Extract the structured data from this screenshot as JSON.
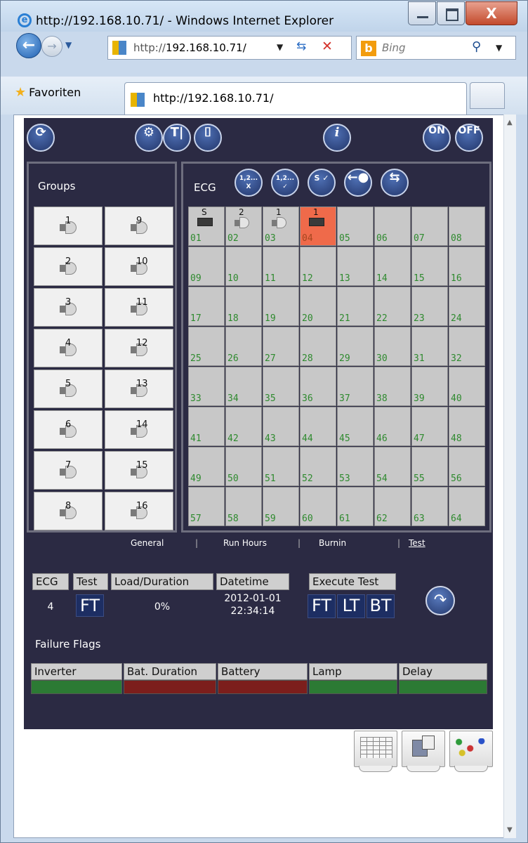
{
  "window": {
    "title": "http://192.168.10.71/ - Windows Internet Explorer",
    "close_label": "X"
  },
  "navbar": {
    "address_prefix": "http://",
    "address_host": "192.168.10.71/",
    "search_placeholder": "Bing"
  },
  "favbar": {
    "favorites_label": "Favoriten",
    "tab_label": "http://192.168.10.71/"
  },
  "toolbar": {
    "on_label": "ON",
    "off_label": "OFF",
    "info_label": "i"
  },
  "groups": {
    "title": "Groups",
    "items": [
      "1",
      "2",
      "3",
      "4",
      "5",
      "6",
      "7",
      "8",
      "9",
      "10",
      "11",
      "12",
      "13",
      "14",
      "15",
      "16"
    ]
  },
  "ecg": {
    "title": "ECG",
    "toolbar": {
      "clear_addr_label": "1,2... X",
      "assign_addr_label": "1,2... ✓",
      "set_label": "S ✓"
    },
    "cells": [
      {
        "n": "01",
        "top": "S",
        "icon": "battery",
        "state": "normal"
      },
      {
        "n": "02",
        "top": "2",
        "icon": "lamp",
        "state": "normal"
      },
      {
        "n": "03",
        "top": "1",
        "icon": "lamp",
        "state": "normal"
      },
      {
        "n": "04",
        "top": "1",
        "icon": "battery",
        "state": "selected"
      },
      {
        "n": "05"
      },
      {
        "n": "06"
      },
      {
        "n": "07"
      },
      {
        "n": "08"
      },
      {
        "n": "09"
      },
      {
        "n": "10"
      },
      {
        "n": "11"
      },
      {
        "n": "12"
      },
      {
        "n": "13"
      },
      {
        "n": "14"
      },
      {
        "n": "15"
      },
      {
        "n": "16"
      },
      {
        "n": "17"
      },
      {
        "n": "18"
      },
      {
        "n": "19"
      },
      {
        "n": "20"
      },
      {
        "n": "21"
      },
      {
        "n": "22"
      },
      {
        "n": "23"
      },
      {
        "n": "24"
      },
      {
        "n": "25"
      },
      {
        "n": "26"
      },
      {
        "n": "27"
      },
      {
        "n": "28"
      },
      {
        "n": "29"
      },
      {
        "n": "30"
      },
      {
        "n": "31"
      },
      {
        "n": "32"
      },
      {
        "n": "33"
      },
      {
        "n": "34"
      },
      {
        "n": "35"
      },
      {
        "n": "36"
      },
      {
        "n": "37"
      },
      {
        "n": "38"
      },
      {
        "n": "39"
      },
      {
        "n": "40"
      },
      {
        "n": "41"
      },
      {
        "n": "42"
      },
      {
        "n": "43"
      },
      {
        "n": "44"
      },
      {
        "n": "45"
      },
      {
        "n": "46"
      },
      {
        "n": "47"
      },
      {
        "n": "48"
      },
      {
        "n": "49"
      },
      {
        "n": "50"
      },
      {
        "n": "51"
      },
      {
        "n": "52"
      },
      {
        "n": "53"
      },
      {
        "n": "54"
      },
      {
        "n": "55"
      },
      {
        "n": "56"
      },
      {
        "n": "57"
      },
      {
        "n": "58"
      },
      {
        "n": "59"
      },
      {
        "n": "60"
      },
      {
        "n": "61"
      },
      {
        "n": "62"
      },
      {
        "n": "63"
      },
      {
        "n": "64"
      }
    ]
  },
  "tabs": [
    {
      "label": "General"
    },
    {
      "label": "Run Hours"
    },
    {
      "label": "Burnin"
    },
    {
      "label": "Test",
      "active": true
    }
  ],
  "test": {
    "headers": {
      "ecg": "ECG",
      "test": "Test",
      "load": "Load/Duration",
      "datetime": "Datetime",
      "execute": "Execute Test"
    },
    "values": {
      "ecg": "4",
      "test": "FT",
      "load": "0%",
      "date": "2012-01-01",
      "time": "22:34:14"
    },
    "execute_buttons": {
      "ft": "FT",
      "lt": "LT",
      "bt": "BT"
    }
  },
  "failure_flags": {
    "title": "Failure Flags",
    "items": [
      {
        "label": "Inverter",
        "status": "ok"
      },
      {
        "label": "Bat. Duration",
        "status": "fail"
      },
      {
        "label": "Battery",
        "status": "fail"
      },
      {
        "label": "Lamp",
        "status": "ok"
      },
      {
        "label": "Delay",
        "status": "ok"
      }
    ]
  },
  "colors": {
    "panel_bg": "#2b2a43",
    "ok": "#2c7a34",
    "fail": "#7c1e1c",
    "selected": "#ef6a4a",
    "ecg_number": "#2e8a2e"
  }
}
